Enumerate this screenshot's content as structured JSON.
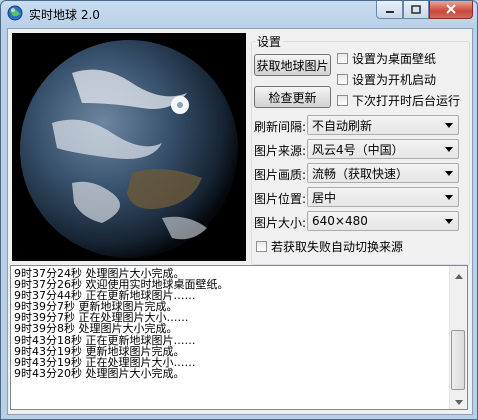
{
  "window": {
    "title": "实时地球 2.0"
  },
  "settings": {
    "group_label": "设置",
    "fetch_button": "获取地球图片",
    "check_update_button": "检查更新",
    "checkboxes": [
      {
        "label": "设置为桌面壁纸",
        "checked": false
      },
      {
        "label": "设置为开机启动",
        "checked": false
      },
      {
        "label": "下次打开时后台运行",
        "checked": false
      }
    ],
    "fields": [
      {
        "label": "刷新间隔:",
        "value": "不自动刷新"
      },
      {
        "label": "图片来源:",
        "value": "风云4号（中国）"
      },
      {
        "label": "图片画质:",
        "value": "流畅（获取快速）"
      },
      {
        "label": "图片位置:",
        "value": "居中"
      },
      {
        "label": "图片大小:",
        "value": "640×480"
      }
    ],
    "auto_switch": {
      "label": "若获取失败自动切换来源",
      "checked": false
    }
  },
  "log": [
    "9时37分24秒  处理图片大小完成。",
    "9时37分26秒  欢迎使用实时地球桌面壁纸。",
    "9时37分44秒  正在更新地球图片……",
    "9时39分7秒  更新地球图片完成。",
    "9时39分7秒  正在处理图片大小……",
    "9时39分8秒  处理图片大小完成。",
    "9时43分18秒  正在更新地球图片……",
    "9时43分19秒  更新地球图片完成。",
    "9时43分19秒  正在处理图片大小……",
    "9时43分20秒  处理图片大小完成。"
  ],
  "colors": {
    "title_bar": "#b8cfe8",
    "close": "#c9483a",
    "client_bg": "#f0f0f0"
  }
}
